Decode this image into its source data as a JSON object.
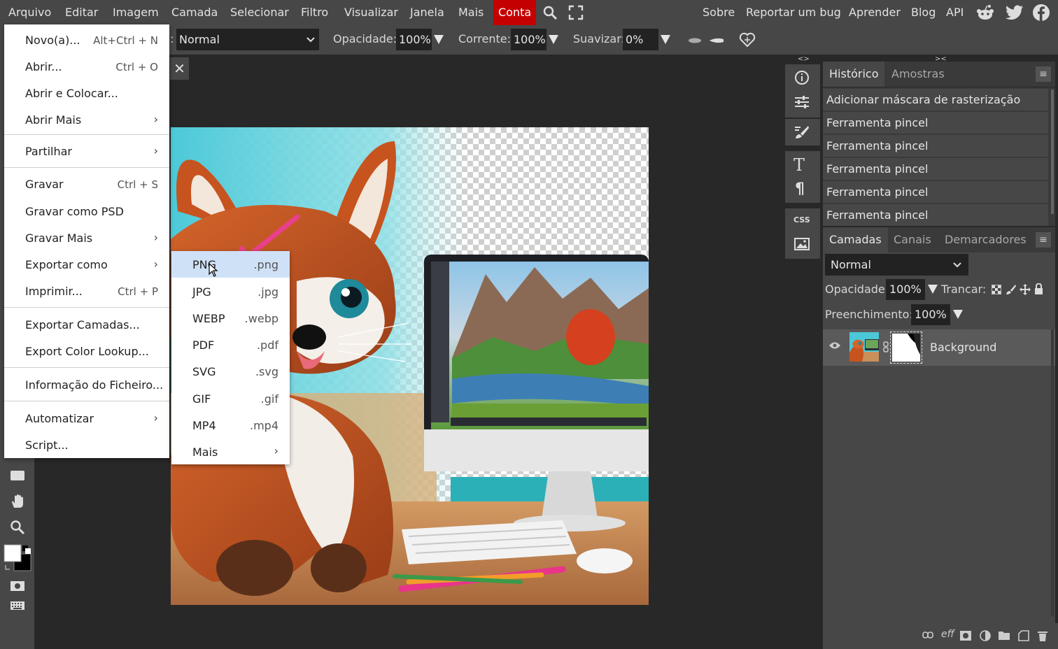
{
  "menubar": {
    "items": [
      "Arquivo",
      "Editar",
      "Imagem",
      "Camada",
      "Selecionar",
      "Filtro",
      "Visualizar",
      "Janela",
      "Mais"
    ],
    "account": "Conta",
    "right_links": [
      "Sobre",
      "Reportar um bug",
      "Aprender",
      "Blog",
      "API"
    ],
    "icons": [
      "search-icon",
      "fullscreen-icon",
      "reddit-icon",
      "twitter-icon",
      "facebook-icon"
    ]
  },
  "options": {
    "mode_prefix": ":",
    "mode_value": "Normal",
    "opacity_label": "Opacidade:",
    "opacity_value": "100%",
    "flow_label": "Corrente:",
    "flow_value": "100%",
    "smooth_label": "Suavizar:",
    "smooth_value": "0%"
  },
  "file_menu": {
    "items": [
      {
        "label": "Novo(a)...",
        "shortcut": "Alt+Ctrl + N"
      },
      {
        "label": "Abrir...",
        "shortcut": "Ctrl + O"
      },
      {
        "label": "Abrir e Colocar..."
      },
      {
        "label": "Abrir Mais",
        "submenu": true
      },
      {
        "label": "Partilhar",
        "submenu": true
      },
      {
        "label": "Gravar",
        "shortcut": "Ctrl + S"
      },
      {
        "label": "Gravar como PSD"
      },
      {
        "label": "Gravar Mais",
        "submenu": true
      },
      {
        "label": "Exportar como",
        "submenu": true
      },
      {
        "label": "Imprimir...",
        "shortcut": "Ctrl + P"
      },
      {
        "label": "Exportar Camadas..."
      },
      {
        "label": "Export Color Lookup..."
      },
      {
        "label": "Informação do Ficheiro..."
      },
      {
        "label": "Automatizar",
        "submenu": true
      },
      {
        "label": "Script..."
      }
    ]
  },
  "export_submenu": {
    "items": [
      {
        "label": "PNG",
        "ext": ".png",
        "highlighted": true
      },
      {
        "label": "JPG",
        "ext": ".jpg"
      },
      {
        "label": "WEBP",
        "ext": ".webp"
      },
      {
        "label": "PDF",
        "ext": ".pdf"
      },
      {
        "label": "SVG",
        "ext": ".svg"
      },
      {
        "label": "GIF",
        "ext": ".gif"
      },
      {
        "label": "MP4",
        "ext": ".mp4"
      },
      {
        "label": "Mais",
        "submenu": true
      }
    ]
  },
  "history_panel": {
    "tabs": [
      "Histórico",
      "Amostras"
    ],
    "entries": [
      "Adicionar máscara de rasterização",
      "Ferramenta pincel",
      "Ferramenta pincel",
      "Ferramenta pincel",
      "Ferramenta pincel",
      "Ferramenta pincel"
    ]
  },
  "layers_panel": {
    "tabs": [
      "Camadas",
      "Canais",
      "Demarcadores"
    ],
    "blend_mode": "Normal",
    "opacity_label": "Opacidade:",
    "opacity_value": "100%",
    "lock_label": "Trancar:",
    "fill_label": "Preenchimento:",
    "fill_value": "100%",
    "layers": [
      {
        "name": "Background"
      }
    ]
  },
  "right_strip": {
    "css_label": "CSS"
  },
  "colors": {
    "accent": "#c50000",
    "arrow": "#e8408a",
    "highlight": "#cfe1f7"
  }
}
